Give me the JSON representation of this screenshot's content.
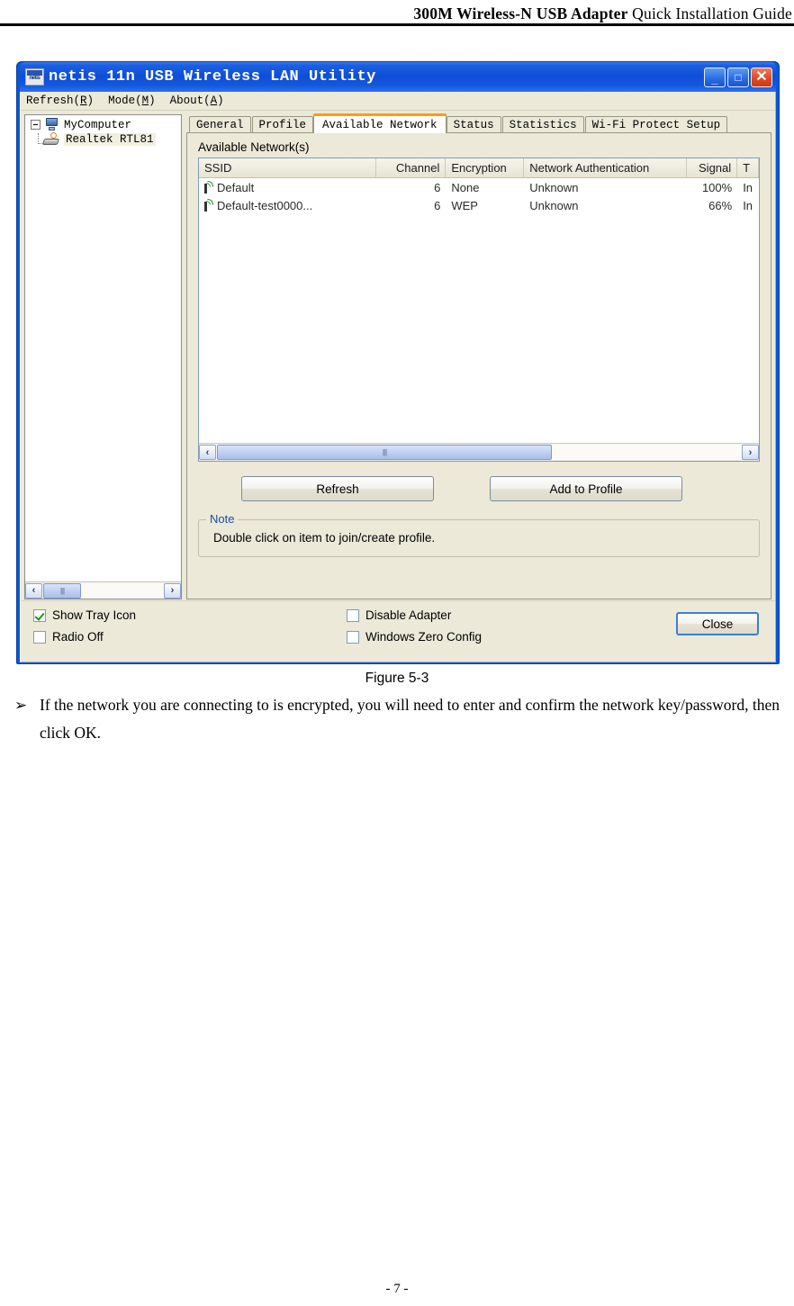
{
  "document": {
    "header_bold": "300M Wireless-N USB Adapter",
    "header_normal": "Quick Installation Guide",
    "figure_caption": "Figure 5-3",
    "bullet_mark": "➢",
    "bullet_text": "If the network you are connecting to is encrypted, you will need to enter and confirm the network key/password, then click OK.",
    "page_number": "- 7 -"
  },
  "window": {
    "title": "netis 11n USB Wireless LAN Utility",
    "icon": "netis-logo-icon",
    "controls": {
      "minimize": "_",
      "maximize": "□",
      "close": "✕"
    }
  },
  "menubar": {
    "items": [
      {
        "text": "Refresh(R)",
        "label": "Refresh",
        "accel": "R"
      },
      {
        "text": "Mode(M)",
        "label": "Mode",
        "accel": "M"
      },
      {
        "text": "About(A)",
        "label": "About",
        "accel": "A"
      }
    ]
  },
  "tree": {
    "root": "MyComputer",
    "child": "Realtek RTL81",
    "expander": "-"
  },
  "tabs": {
    "items": [
      {
        "label": "General",
        "active": false
      },
      {
        "label": "Profile",
        "active": false
      },
      {
        "label": "Available Network",
        "active": true
      },
      {
        "label": "Status",
        "active": false
      },
      {
        "label": "Statistics",
        "active": false
      },
      {
        "label": "Wi-Fi Protect Setup",
        "active": false
      }
    ],
    "active_accent": "#ff9d00"
  },
  "available_network": {
    "section_label": "Available Network(s)",
    "columns": [
      "SSID",
      "Channel",
      "Encryption",
      "Network Authentication",
      "Signal",
      "T"
    ],
    "rows": [
      {
        "ssid": "Default",
        "channel": "6",
        "encryption": "None",
        "authentication": "Unknown",
        "signal": "100%",
        "type": "In"
      },
      {
        "ssid": "Default-test0000...",
        "channel": "6",
        "encryption": "WEP",
        "authentication": "Unknown",
        "signal": "66%",
        "type": "In"
      }
    ],
    "buttons": {
      "refresh": "Refresh",
      "add_to_profile": "Add to Profile"
    },
    "note": {
      "title": "Note",
      "text": "Double click on item to join/create profile."
    },
    "scroll_left_arrow": "‹",
    "scroll_right_arrow": "›"
  },
  "bottom": {
    "checkboxes": [
      {
        "label": "Show Tray Icon",
        "checked": true
      },
      {
        "label": "Radio Off",
        "checked": false
      },
      {
        "label": "Disable Adapter",
        "checked": false
      },
      {
        "label": "Windows Zero Config",
        "checked": false
      }
    ],
    "close_button": "Close"
  }
}
